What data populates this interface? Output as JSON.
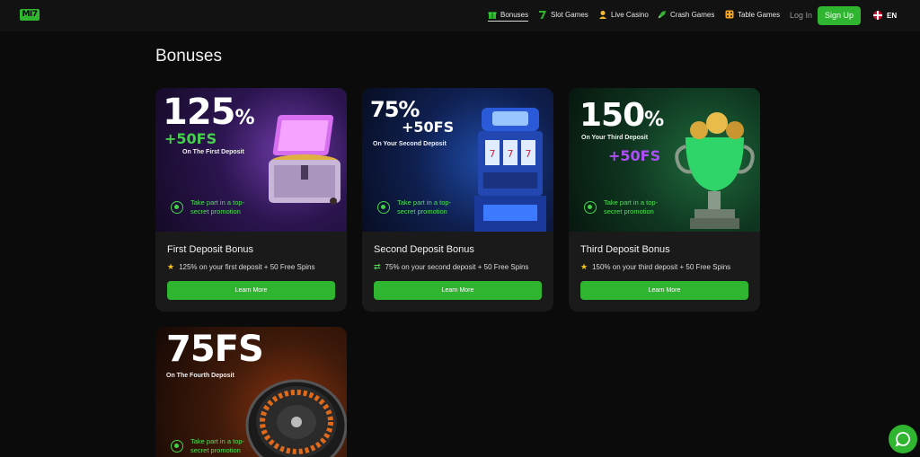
{
  "brand": {
    "logo_text": "MI7"
  },
  "nav": {
    "items": [
      {
        "label": "Bonuses",
        "icon": "gift-icon",
        "active": true
      },
      {
        "label": "Slot Games",
        "icon": "seven-icon",
        "active": false
      },
      {
        "label": "Live Casino",
        "icon": "dealer-icon",
        "active": false
      },
      {
        "label": "Crash Games",
        "icon": "rocket-icon",
        "active": false
      },
      {
        "label": "Table Games",
        "icon": "dice-icon",
        "active": false
      }
    ],
    "login_label": "Log In",
    "signup_label": "Sign Up",
    "language": "EN"
  },
  "page": {
    "title": "Bonuses"
  },
  "cards": [
    {
      "headline_number": "125",
      "headline_suffix": "%",
      "extra": "+50FS",
      "subtitle": "On The First Deposit",
      "promo": "Take part in a top-secret promotion",
      "title": "First Deposit Bonus",
      "description": "125% on your first deposit + 50 Free Spins",
      "button": "Learn More"
    },
    {
      "headline_number": "75",
      "headline_suffix": "%",
      "extra": "+50FS",
      "subtitle": "On Your Second Deposit",
      "promo": "Take part in a top-secret promotion",
      "title": "Second Deposit Bonus",
      "description": "75% on your second deposit + 50 Free Spins",
      "button": "Learn More"
    },
    {
      "headline_number": "150",
      "headline_suffix": "%",
      "extra": "+50FS",
      "subtitle": "On Your Third Deposit",
      "promo": "Take part in a top-secret promotion",
      "title": "Third Deposit Bonus",
      "description": "150% on your third deposit + 50 Free Spins",
      "button": "Learn More"
    },
    {
      "headline_number": "75FS",
      "headline_suffix": "",
      "extra": "",
      "subtitle": "On The Fourth Deposit",
      "promo": "Take part in a top-secret promotion"
    }
  ],
  "colors": {
    "accent": "#2fb52f",
    "promo_text": "#4ee354",
    "purple_extra": "#b14dff",
    "green_extra": "#43d24a"
  }
}
